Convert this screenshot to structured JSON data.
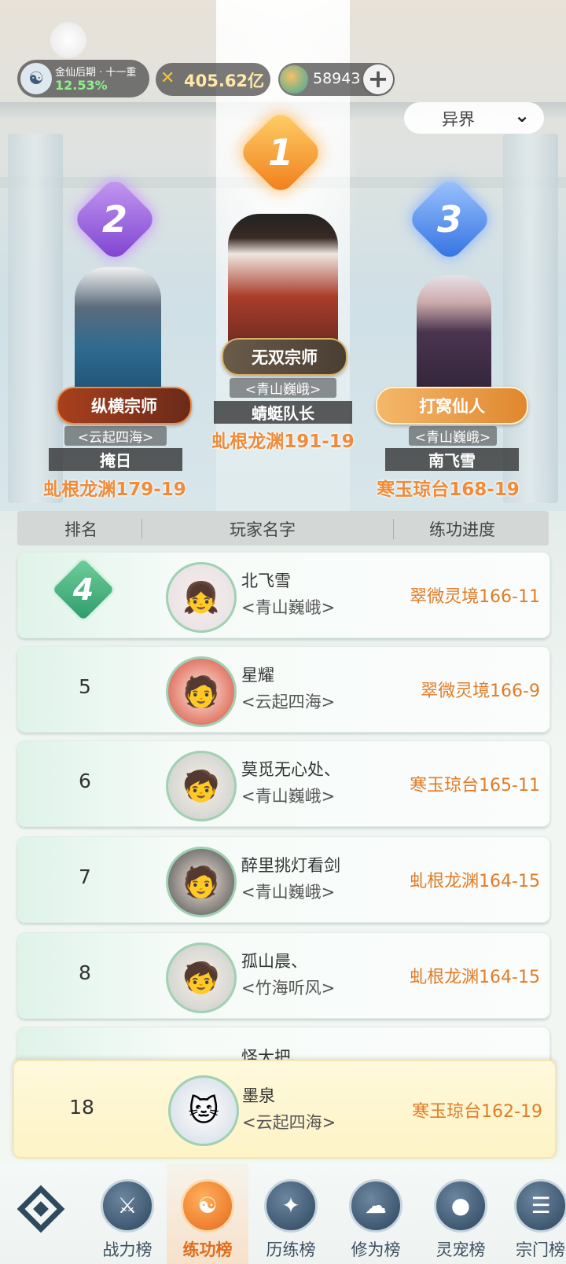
{
  "status": {
    "realm_name": "金仙后期 · 十一重",
    "realm_percent": "12.53%",
    "gold": "405.62亿",
    "gems": "58943",
    "plus_icon": "plus-icon"
  },
  "server_select": {
    "label": "异界",
    "icon": "chevron-down-icon"
  },
  "podium": [
    {
      "rank": "2",
      "title": "纵横宗师",
      "guild": "<云起四海>",
      "name": "掩日",
      "progress": "虬根龙渊179-19"
    },
    {
      "rank": "1",
      "title": "无双宗师",
      "guild": "<青山巍峨>",
      "name": "蜻蜓队长",
      "progress": "虬根龙渊191-19"
    },
    {
      "rank": "3",
      "title": "打窝仙人",
      "guild": "<青山巍峨>",
      "name": "南飞雪",
      "progress": "寒玉琼台168-19"
    }
  ],
  "table_header": {
    "rank": "排名",
    "player": "玩家名字",
    "progress": "练功进度"
  },
  "rows": [
    {
      "rank": "4",
      "name": "北飞雪",
      "guild": "<青山巍峨>",
      "progress": "翠微灵境166-11"
    },
    {
      "rank": "5",
      "name": "星耀",
      "guild": "<云起四海>",
      "progress": "翠微灵境166-9"
    },
    {
      "rank": "6",
      "name": "莫觅无心处、",
      "guild": "<青山巍峨>",
      "progress": "寒玉琼台165-11"
    },
    {
      "rank": "7",
      "name": "醉里挑灯看剑",
      "guild": "<青山巍峨>",
      "progress": "虬根龙渊164-15"
    },
    {
      "rank": "8",
      "name": "孤山晨、",
      "guild": "<竹海听风>",
      "progress": "虬根龙渊164-15"
    }
  ],
  "partial_row": {
    "name": "怪大把、"
  },
  "self_row": {
    "rank": "18",
    "name": "墨泉",
    "guild": "<云起四海>",
    "progress": "寒玉琼台162-19"
  },
  "nav": [
    {
      "label": "战力榜",
      "icon": "crossed-swords-icon"
    },
    {
      "label": "练功榜",
      "icon": "yin-yang-icon"
    },
    {
      "label": "历练榜",
      "icon": "compass-icon"
    },
    {
      "label": "修为榜",
      "icon": "cultivator-hat-icon"
    },
    {
      "label": "灵宠榜",
      "icon": "cat-face-icon"
    },
    {
      "label": "宗门榜",
      "icon": "scroll-icon"
    }
  ],
  "colors": {
    "accent": "#e07c27",
    "rank1": "#f39a2c",
    "rank2": "#9b5be0",
    "rank3": "#4f86e6",
    "self_bg": "#fdf3c6"
  }
}
